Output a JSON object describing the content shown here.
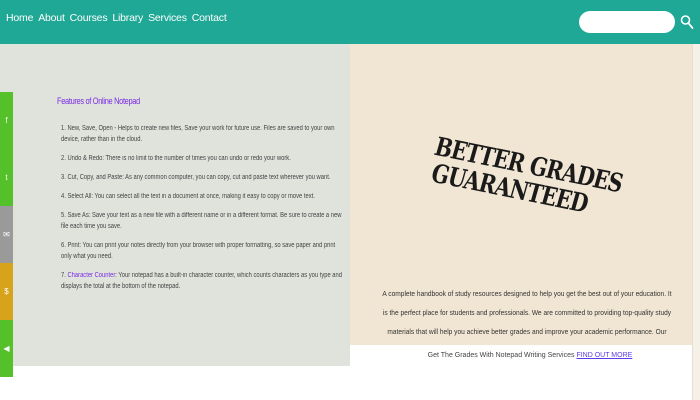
{
  "nav": {
    "home": "Home",
    "about": "About",
    "courses": "Courses",
    "library": "Library",
    "services": "Services",
    "contact": "Contact"
  },
  "search": {
    "placeholder": ""
  },
  "social": [
    {
      "icon": "facebook-icon",
      "glyph": "f",
      "color": "#55c12a"
    },
    {
      "icon": "twitter-icon",
      "glyph": "t",
      "color": "#55c12a"
    },
    {
      "icon": "email-icon",
      "glyph": "✉",
      "color": "#9a9a9a"
    },
    {
      "icon": "share-icon",
      "glyph": "$",
      "color": "#d6a31b"
    },
    {
      "icon": "speaker-icon",
      "glyph": "◀",
      "color": "#55c12a"
    }
  ],
  "features": {
    "title": "Features of Online Notepad",
    "items": [
      "1. New, Save, Open - Helps to create new files, Save your work for future use. Files are saved to your own device, rather than in the cloud.",
      "2. Undo & Redo: There is no limit to the number of times you can undo or redo your work.",
      "3. Cut, Copy, and Paste: As any common computer, you can copy, cut and paste text wherever you want.",
      "4. Select All: You can select all the text in a document at once, making it easy to copy or move text.",
      "5. Save As: Save your text as a new file with a different name or in a different format. Be sure to create a new file each time you save.",
      "6. Print: You can print your notes directly from your browser with proper formatting, so save paper and print only what you need.",
      "7. Character Counter: Your notepad has a built-in character counter, which counts characters as you type and displays the total at the bottom of the notepad."
    ],
    "link_label": "Character Counter"
  },
  "hero": {
    "line1": "BETTER GRADES",
    "line2": "GUARANTEED"
  },
  "promo": {
    "description": "A complete handbook of study resources designed to help you get the best out of your education. It is the perfect place for students and professionals. We are committed to providing top-quality study materials that will help you achieve better grades and improve your academic performance. Our study resources cover a wide range of subjects and topics to meet the needs of all types of students."
  },
  "cta": {
    "text": "Get The Grades With Notepad Writing Services",
    "link_label": "FIND OUT MORE"
  }
}
